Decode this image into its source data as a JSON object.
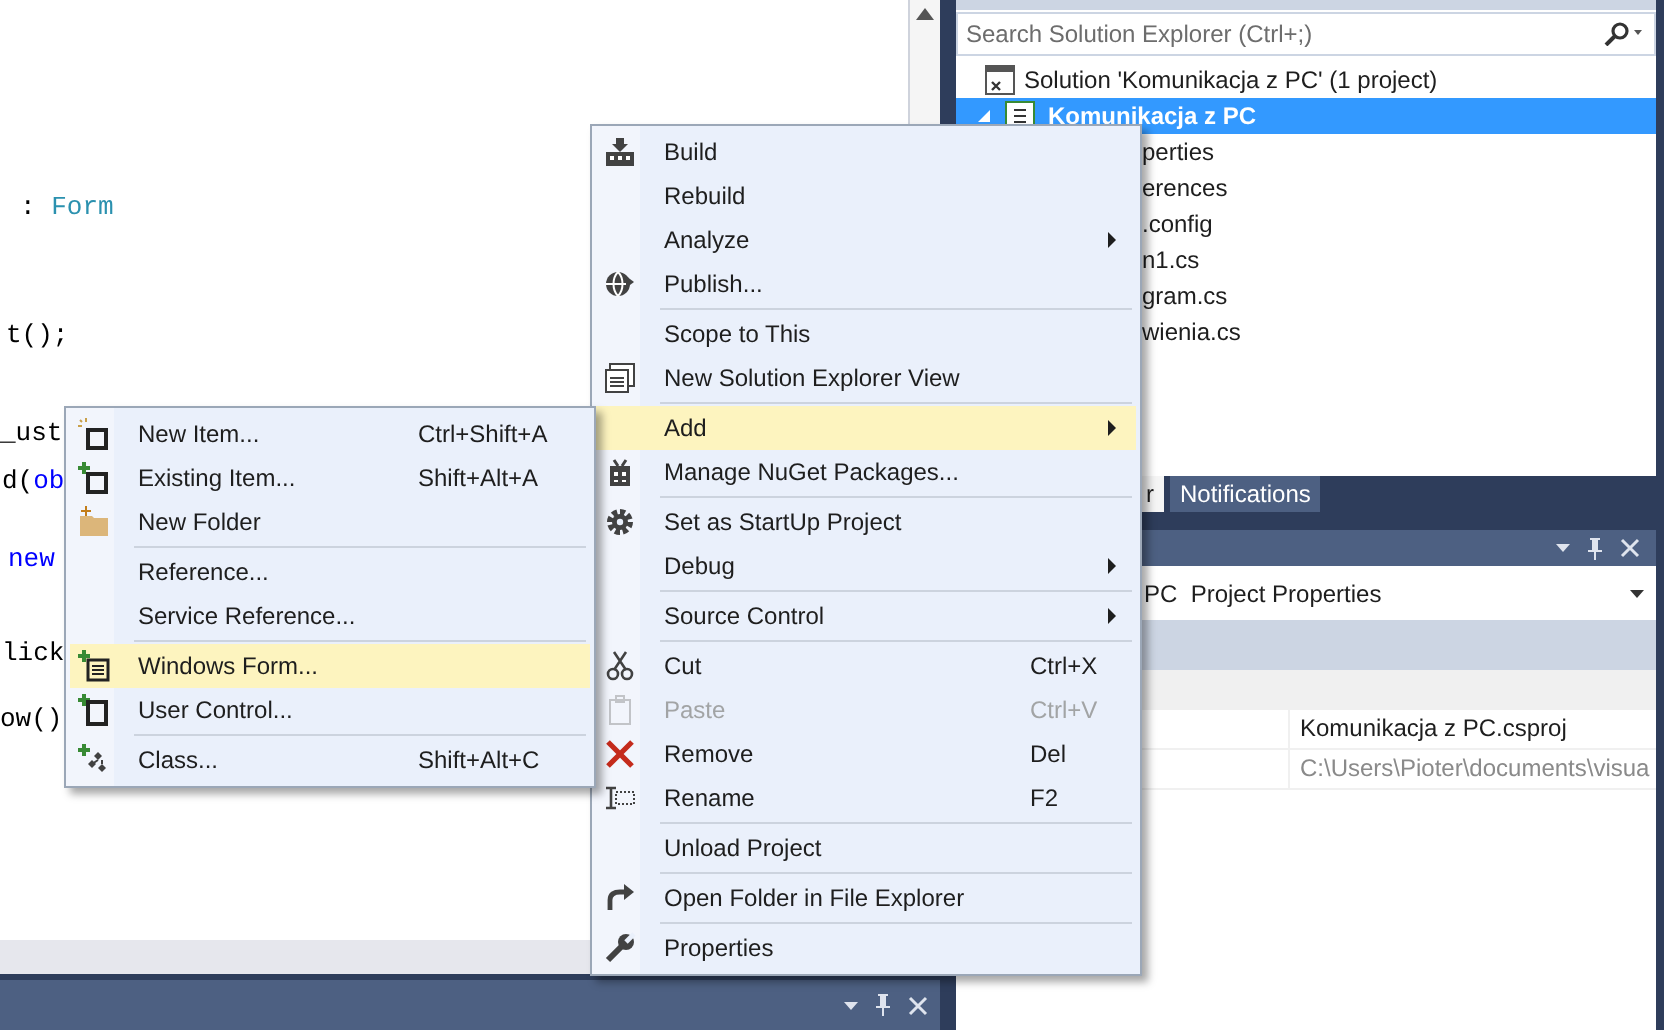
{
  "editor": {
    "code_lines": [
      {
        "segments": [
          {
            "text": ": ",
            "kind": "plain"
          },
          {
            "text": "Form",
            "kind": "type"
          }
        ]
      },
      {
        "segments": [
          {
            "text": "t();",
            "kind": "plain"
          }
        ]
      },
      {
        "segments": [
          {
            "text": "_ust",
            "kind": "plain"
          }
        ]
      },
      {
        "segments": [
          {
            "text": "d(",
            "kind": "plain"
          },
          {
            "text": "ob",
            "kind": "keyword"
          }
        ]
      },
      {
        "segments": [
          {
            "text": "new",
            "kind": "keyword"
          }
        ]
      },
      {
        "segments": [
          {
            "text": "lick",
            "kind": "plain"
          }
        ]
      },
      {
        "segments": [
          {
            "text": "ow()",
            "kind": "plain"
          }
        ]
      }
    ]
  },
  "solution_explorer": {
    "search": {
      "placeholder": "Search Solution Explorer (Ctrl+;)"
    },
    "tree": [
      {
        "label": "Solution 'Komunikacja z PC' (1 project)",
        "kind": "solution",
        "selected": false,
        "children": [
          {
            "label": "Komunikacja z PC",
            "kind": "project",
            "selected": true,
            "expanded": true,
            "children": [
              {
                "label": "perties",
                "selected": false
              },
              {
                "label": "erences",
                "selected": false
              },
              {
                "label": ".config",
                "selected": false
              },
              {
                "label": "n1.cs",
                "selected": false
              },
              {
                "label": "gram.cs",
                "selected": false
              },
              {
                "label": "wienia.cs",
                "selected": false
              }
            ]
          }
        ]
      }
    ],
    "tabs": [
      {
        "label": "r",
        "selected": true
      },
      {
        "label": "Notifications",
        "selected": false
      }
    ]
  },
  "properties": {
    "object": "PC  Project Properties",
    "rows": [
      {
        "value": "Komunikacja z PC.csproj",
        "disabled": false
      },
      {
        "value": "C:\\Users\\Pioter\\documents\\visua",
        "disabled": true
      }
    ]
  },
  "context_menu": {
    "items": [
      {
        "kind": "item",
        "label": "Build",
        "selected": false,
        "disabled": false,
        "submenu": false
      },
      {
        "kind": "item",
        "label": "Rebuild",
        "selected": false,
        "disabled": false,
        "submenu": false
      },
      {
        "kind": "item",
        "label": "Analyze",
        "selected": false,
        "disabled": false,
        "submenu": true
      },
      {
        "kind": "item",
        "label": "Publish...",
        "selected": false,
        "disabled": false,
        "submenu": false
      },
      {
        "kind": "separator"
      },
      {
        "kind": "item",
        "label": "Scope to This",
        "selected": false,
        "disabled": false,
        "submenu": false
      },
      {
        "kind": "item",
        "label": "New Solution Explorer View",
        "selected": false,
        "disabled": false,
        "submenu": false
      },
      {
        "kind": "separator"
      },
      {
        "kind": "item",
        "label": "Add",
        "selected": true,
        "disabled": false,
        "submenu": true
      },
      {
        "kind": "item",
        "label": "Manage NuGet Packages...",
        "selected": false,
        "disabled": false,
        "submenu": false
      },
      {
        "kind": "separator"
      },
      {
        "kind": "item",
        "label": "Set as StartUp Project",
        "selected": false,
        "disabled": false,
        "submenu": false
      },
      {
        "kind": "item",
        "label": "Debug",
        "selected": false,
        "disabled": false,
        "submenu": true
      },
      {
        "kind": "separator"
      },
      {
        "kind": "item",
        "label": "Source Control",
        "selected": false,
        "disabled": false,
        "submenu": true
      },
      {
        "kind": "separator"
      },
      {
        "kind": "item",
        "label": "Cut",
        "shortcut": "Ctrl+X",
        "selected": false,
        "disabled": false,
        "submenu": false
      },
      {
        "kind": "item",
        "label": "Paste",
        "shortcut": "Ctrl+V",
        "selected": false,
        "disabled": true,
        "submenu": false
      },
      {
        "kind": "item",
        "label": "Remove",
        "shortcut": "Del",
        "selected": false,
        "disabled": false,
        "submenu": false
      },
      {
        "kind": "item",
        "label": "Rename",
        "shortcut": "F2",
        "selected": false,
        "disabled": false,
        "submenu": false
      },
      {
        "kind": "separator"
      },
      {
        "kind": "item",
        "label": "Unload Project",
        "selected": false,
        "disabled": false,
        "submenu": false
      },
      {
        "kind": "separator"
      },
      {
        "kind": "item",
        "label": "Open Folder in File Explorer",
        "selected": false,
        "disabled": false,
        "submenu": false
      },
      {
        "kind": "separator"
      },
      {
        "kind": "item",
        "label": "Properties",
        "selected": false,
        "disabled": false,
        "submenu": false
      }
    ]
  },
  "add_submenu": {
    "items": [
      {
        "kind": "item",
        "label": "New Item...",
        "shortcut": "Ctrl+Shift+A",
        "selected": false,
        "disabled": false,
        "submenu": false
      },
      {
        "kind": "item",
        "label": "Existing Item...",
        "shortcut": "Shift+Alt+A",
        "selected": false,
        "disabled": false,
        "submenu": false
      },
      {
        "kind": "item",
        "label": "New Folder",
        "selected": false,
        "disabled": false,
        "submenu": false
      },
      {
        "kind": "separator"
      },
      {
        "kind": "item",
        "label": "Reference...",
        "selected": false,
        "disabled": false,
        "submenu": false
      },
      {
        "kind": "item",
        "label": "Service Reference...",
        "selected": false,
        "disabled": false,
        "submenu": false
      },
      {
        "kind": "separator"
      },
      {
        "kind": "item",
        "label": "Windows Form...",
        "selected": true,
        "disabled": false,
        "submenu": false
      },
      {
        "kind": "item",
        "label": "User Control...",
        "selected": false,
        "disabled": false,
        "submenu": false
      },
      {
        "kind": "separator"
      },
      {
        "kind": "item",
        "label": "Class...",
        "shortcut": "Shift+Alt+C",
        "selected": false,
        "disabled": false,
        "submenu": false
      }
    ]
  }
}
